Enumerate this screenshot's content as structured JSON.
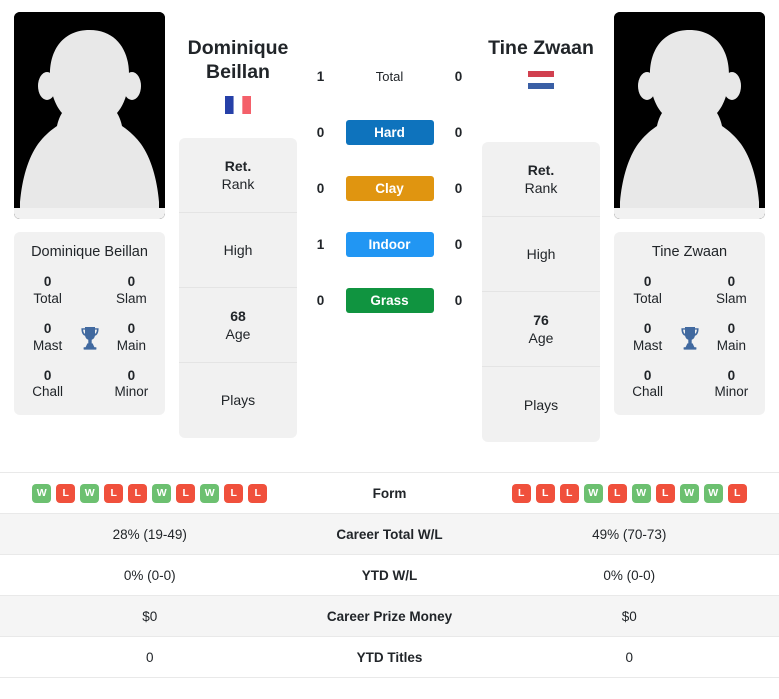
{
  "players": {
    "left": {
      "first_name": "Dominique",
      "last_name": "Beillan",
      "full_name": "Dominique Beillan",
      "country": "France",
      "flag_icon": "flag-france",
      "avatar_icon": "player-silhouette-avatar",
      "titles": [
        {
          "value": "0",
          "label": "Total"
        },
        {
          "value": "0",
          "label": "Slam"
        },
        {
          "value": "0",
          "label": "Mast"
        },
        {
          "value": "0",
          "label": "Main"
        },
        {
          "value": "0",
          "label": "Chall"
        },
        {
          "value": "0",
          "label": "Minor"
        }
      ],
      "info": [
        {
          "value": "Ret.",
          "label": "Rank"
        },
        {
          "value": "",
          "label": "High"
        },
        {
          "value": "68",
          "label": "Age"
        },
        {
          "value": "",
          "label": "Plays"
        }
      ],
      "form": [
        "W",
        "L",
        "W",
        "L",
        "L",
        "W",
        "L",
        "W",
        "L",
        "L"
      ],
      "career_total_wl": "28% (19-49)",
      "ytd_wl": "0% (0-0)",
      "career_prize_money": "$0",
      "ytd_titles": "0"
    },
    "right": {
      "first_name": "Tine",
      "last_name": "Zwaan",
      "full_name": "Tine Zwaan",
      "country": "Netherlands",
      "flag_icon": "flag-netherlands",
      "avatar_icon": "player-silhouette-avatar",
      "titles": [
        {
          "value": "0",
          "label": "Total"
        },
        {
          "value": "0",
          "label": "Slam"
        },
        {
          "value": "0",
          "label": "Mast"
        },
        {
          "value": "0",
          "label": "Main"
        },
        {
          "value": "0",
          "label": "Chall"
        },
        {
          "value": "0",
          "label": "Minor"
        }
      ],
      "info": [
        {
          "value": "Ret.",
          "label": "Rank"
        },
        {
          "value": "",
          "label": "High"
        },
        {
          "value": "76",
          "label": "Age"
        },
        {
          "value": "",
          "label": "Plays"
        }
      ],
      "form": [
        "L",
        "L",
        "L",
        "W",
        "L",
        "W",
        "L",
        "W",
        "W",
        "L"
      ],
      "career_total_wl": "49% (70-73)",
      "ytd_wl": "0% (0-0)",
      "career_prize_money": "$0",
      "ytd_titles": "0"
    }
  },
  "head_to_head": [
    {
      "label": "Total",
      "left": "1",
      "right": "0",
      "color": "",
      "style": "plain"
    },
    {
      "label": "Hard",
      "left": "0",
      "right": "0",
      "color": "#0e73bd",
      "style": "badge"
    },
    {
      "label": "Clay",
      "left": "0",
      "right": "0",
      "color": "#e09510",
      "style": "badge"
    },
    {
      "label": "Indoor",
      "left": "1",
      "right": "0",
      "color": "#2196f3",
      "style": "badge"
    },
    {
      "label": "Grass",
      "left": "0",
      "right": "0",
      "color": "#109440",
      "style": "badge"
    }
  ],
  "table": {
    "form_label": "Form",
    "rows": [
      {
        "label": "Career Total W/L",
        "left": "28% (19-49)",
        "right": "49% (70-73)"
      },
      {
        "label": "YTD W/L",
        "left": "0% (0-0)",
        "right": "0% (0-0)"
      },
      {
        "label": "Career Prize Money",
        "left": "$0",
        "right": "$0"
      },
      {
        "label": "YTD Titles",
        "left": "0",
        "right": "0"
      }
    ]
  },
  "colors": {
    "win": "#6cc070",
    "loss": "#f0503c",
    "card_bg": "#f1f1f1",
    "row_alt_bg": "#f5f5f5",
    "text": "#212529"
  }
}
